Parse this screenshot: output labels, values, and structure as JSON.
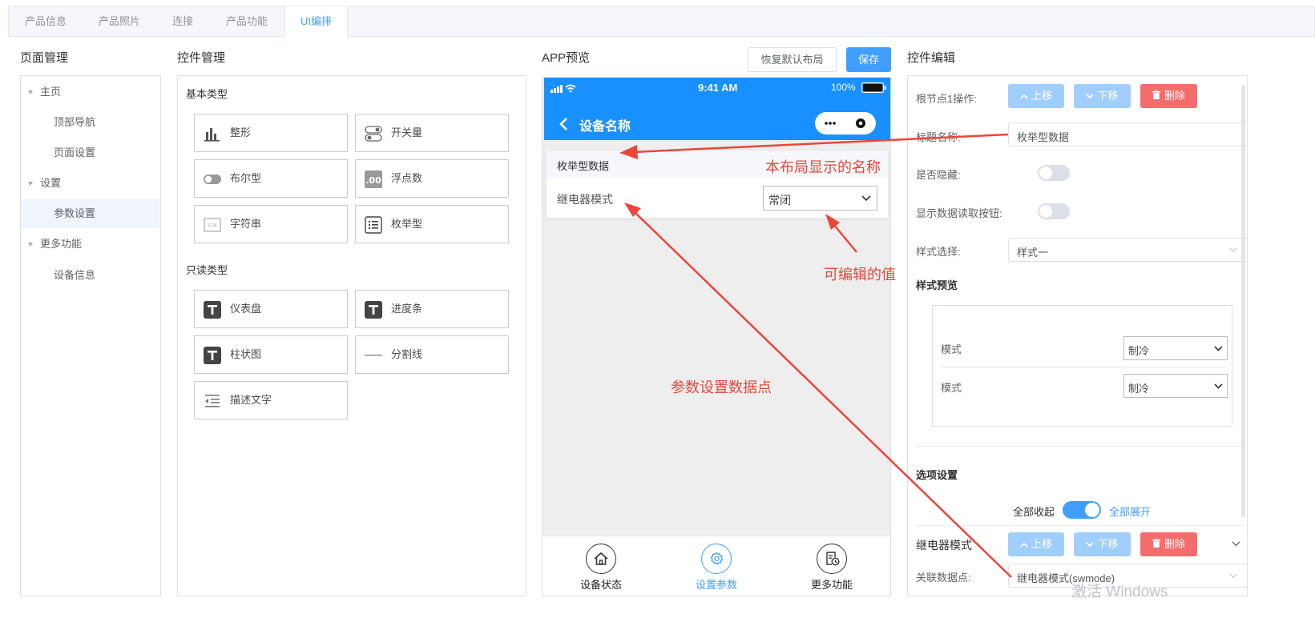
{
  "tabs": [
    "产品信息",
    "产品照片",
    "连接",
    "产品功能",
    "UI编排"
  ],
  "page_manager": {
    "title": "页面管理",
    "tree": [
      {
        "label": "主页",
        "level": 0
      },
      {
        "label": "顶部导航",
        "level": 1
      },
      {
        "label": "页面设置",
        "level": 1
      },
      {
        "label": "设置",
        "level": 0
      },
      {
        "label": "参数设置",
        "level": 1,
        "selected": true
      },
      {
        "label": "更多功能",
        "level": 0
      },
      {
        "label": "设备信息",
        "level": 1
      }
    ]
  },
  "widget_manager": {
    "title": "控件管理",
    "basic_label": "基本类型",
    "readonly_label": "只读类型",
    "basic": [
      {
        "label": "整形",
        "icon": "bar-chart-icon"
      },
      {
        "label": "开关量",
        "icon": "switch-icon"
      },
      {
        "label": "布尔型",
        "icon": "toggle-icon"
      },
      {
        "label": "浮点数",
        "icon": "float-icon",
        "badge": ".00"
      },
      {
        "label": "字符串",
        "icon": "string-icon",
        "badge": "STR"
      },
      {
        "label": "枚举型",
        "icon": "list-icon"
      }
    ],
    "readonly": [
      {
        "label": "仪表盘",
        "icon": "text-t-icon"
      },
      {
        "label": "进度条",
        "icon": "text-t-icon"
      },
      {
        "label": "柱状图",
        "icon": "text-t-icon"
      },
      {
        "label": "分割线",
        "icon": "divider-icon"
      },
      {
        "label": "描述文字",
        "icon": "indent-icon"
      }
    ]
  },
  "preview": {
    "title": "APP预览",
    "restore_label": "恢复默认布局",
    "save_label": "保存",
    "status_time": "9:41 AM",
    "status_battery": "100%",
    "nav_title": "设备名称",
    "card_title": "枚举型数据",
    "field_label": "继电器模式",
    "field_value": "常闭",
    "tabbar": [
      {
        "label": "设备状态",
        "icon": "home-icon",
        "active": false
      },
      {
        "label": "设置参数",
        "icon": "gear-icon",
        "active": true
      },
      {
        "label": "更多功能",
        "icon": "doc-clock-icon",
        "active": false
      }
    ]
  },
  "annotations": {
    "name": "本布局显示的名称",
    "editable": "可编辑的值",
    "datapoint": "参数设置数据点"
  },
  "editor": {
    "title": "控件编辑",
    "root_op_label": "根节点1操作:",
    "up_label": "上移",
    "down_label": "下移",
    "delete_label": "删除",
    "title_name_label": "标题名称:",
    "title_name_value": "枚举型数据",
    "hidden_label": "是否隐藏:",
    "read_btn_label": "显示数据读取按钮:",
    "style_label": "样式选择:",
    "style_value": "样式一",
    "style_preview_label": "样式预览",
    "preview_rows": [
      {
        "label": "模式",
        "value": "制冷"
      },
      {
        "label": "模式",
        "value": "制冷"
      }
    ],
    "option_settings_label": "选项设置",
    "collapse_all": "全部收起",
    "expand_all": "全部展开",
    "item_name": "继电器模式",
    "linked_label": "关联数据点:",
    "linked_value": "继电器模式(swmode)"
  },
  "colors": {
    "primary": "#409eff",
    "phone_blue": "#1890ff",
    "danger": "#f56c6c",
    "annotation": "#e8473a"
  },
  "watermark": "激活 Windows"
}
